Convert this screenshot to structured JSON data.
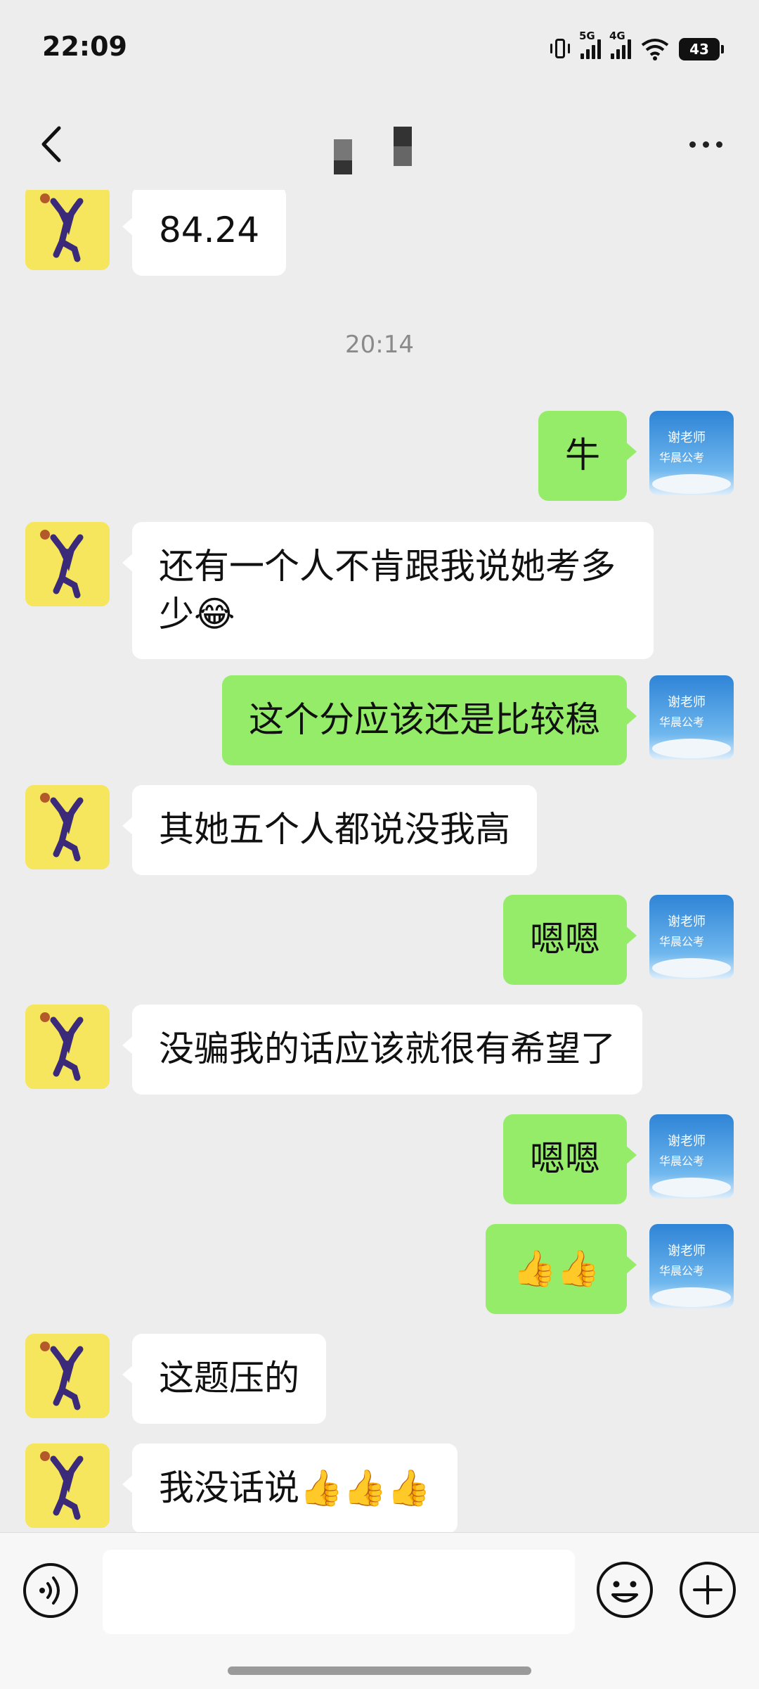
{
  "status_bar": {
    "time": "22:09",
    "signal_1": "5G",
    "signal_2": "4G",
    "battery": "43"
  },
  "header": {
    "back_icon": "chevron-left-icon",
    "more_icon": "more-dots-icon"
  },
  "messages": [
    {
      "side": "in",
      "text": "84.24"
    },
    {
      "timestamp": "20:14"
    },
    {
      "side": "out",
      "text": "牛"
    },
    {
      "side": "in",
      "text": "还有一个人不肯跟我说她考多少😂"
    },
    {
      "side": "out",
      "text": "这个分应该还是比较稳"
    },
    {
      "side": "in",
      "text": "其她五个人都说没我高"
    },
    {
      "side": "out",
      "text": "嗯嗯"
    },
    {
      "side": "in",
      "text": "没骗我的话应该就很有希望了"
    },
    {
      "side": "out",
      "text": "嗯嗯"
    },
    {
      "side": "out",
      "text": "👍👍"
    },
    {
      "side": "in",
      "text": "这题压的"
    },
    {
      "side": "in",
      "text": "我没话说👍👍👍"
    }
  ],
  "right_avatar_text": {
    "line1": "谢老师",
    "line2": "华晨公考"
  },
  "input_bar": {
    "placeholder": "",
    "voice_icon": "voice-icon",
    "emoji_icon": "emoji-icon",
    "plus_icon": "plus-icon"
  },
  "colors": {
    "background": "#EDEDED",
    "outgoing_bubble": "#95EC69",
    "incoming_bubble": "#FFFFFF"
  }
}
